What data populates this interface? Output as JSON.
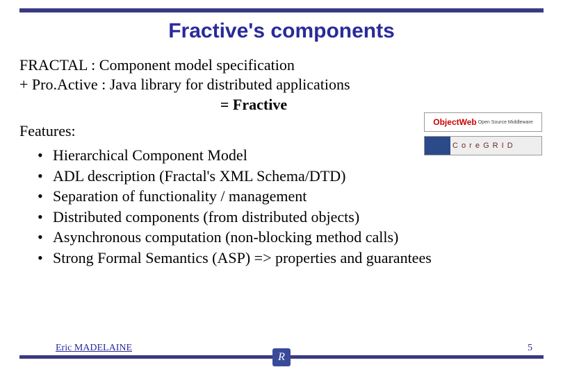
{
  "title": "Fractive's components",
  "line1": "FRACTAL : Component model specification",
  "line2": "+ Pro.Active : Java library for distributed applications",
  "equation": "= Fractive",
  "features_label": "Features:",
  "bullets": [
    "Hierarchical Component Model",
    "ADL description (Fractal's XML Schema/DTD)",
    "Separation of functionality / management",
    "Distributed components (from distributed objects)",
    "Asynchronous computation (non-blocking method calls)",
    "Strong Formal Semantics (ASP) =>  properties and guarantees"
  ],
  "logos": {
    "objectweb": {
      "main": "ObjectWeb",
      "sub": "Open Source Middleware"
    },
    "coregrid": "C o r e G R I D"
  },
  "footer": {
    "author": "Eric MADELAINE",
    "page": "5",
    "badge": "R"
  }
}
